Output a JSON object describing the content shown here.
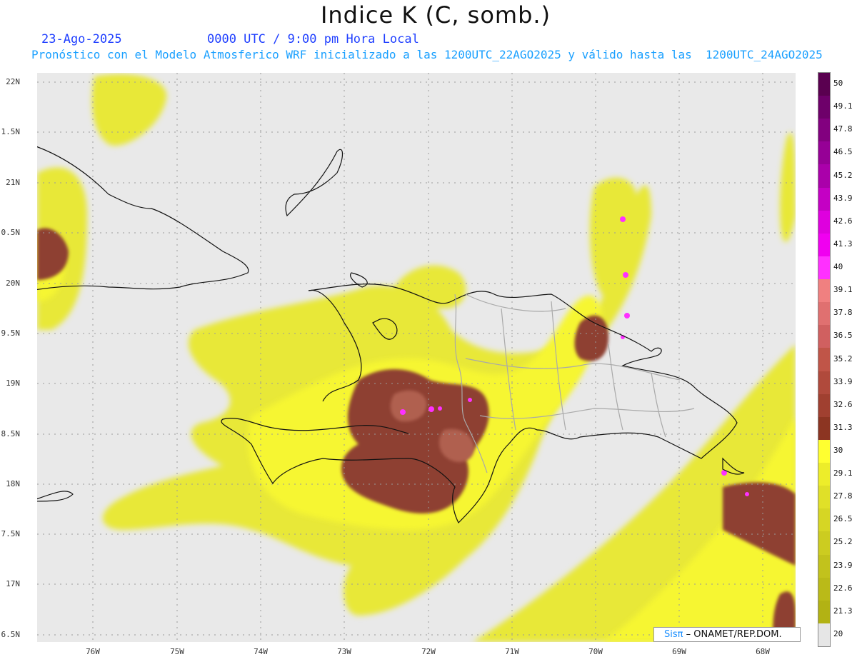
{
  "header": {
    "title": "Indice K (C, somb.)",
    "date": "23-Ago-2025",
    "time": "0000 UTC / 9:00 pm Hora Local",
    "subtitle": "Pronóstico con el Modelo Atmosferico WRF inicializado a las 1200UTC_22AGO2025 y válido hasta las  1200UTC_24AGO2025"
  },
  "map": {
    "lat_labels": [
      "22N",
      "1.5N",
      "21N",
      "0.5N",
      "20N",
      "9.5N",
      "19N",
      "8.5N",
      "18N",
      "7.5N",
      "17N",
      "6.5N"
    ],
    "lon_labels": [
      "76W",
      "75W",
      "74W",
      "73W",
      "72W",
      "71W",
      "70W",
      "69W",
      "68W"
    ],
    "background_color": "#e9e9e9"
  },
  "colorbar": {
    "labels": [
      "50",
      "49.1",
      "47.8",
      "46.5",
      "45.2",
      "43.9",
      "42.6",
      "41.3",
      "40",
      "39.1",
      "37.8",
      "36.5",
      "35.2",
      "33.9",
      "32.6",
      "31.3",
      "30",
      "29.1",
      "27.8",
      "26.5",
      "25.2",
      "23.9",
      "22.6",
      "21.3",
      "20"
    ],
    "colors": [
      "#5a0050",
      "#6e006a",
      "#82007f",
      "#960096",
      "#aa00aa",
      "#c400c4",
      "#de00de",
      "#f000f0",
      "#ff30ff",
      "#f08080",
      "#e07070",
      "#d06060",
      "#c05548",
      "#b04a3c",
      "#a04030",
      "#8c3522",
      "#ffff30",
      "#eded2a",
      "#e0e028",
      "#d6d624",
      "#cccc20",
      "#c2c21c",
      "#baba18",
      "#b2b214",
      "#e6e6e6"
    ]
  },
  "credit": {
    "logo": "Sisπ",
    "text": "– ONAMET/REP.DOM."
  }
}
